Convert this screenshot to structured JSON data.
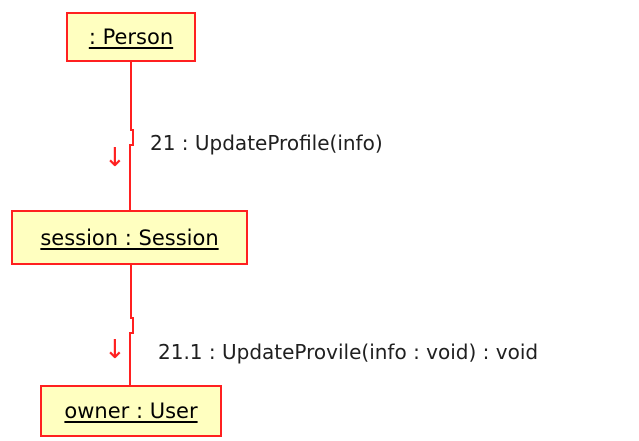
{
  "objects": [
    {
      "label": " : Person"
    },
    {
      "label": "session : Session"
    },
    {
      "label": "owner : User"
    }
  ],
  "messages": [
    {
      "label": "21 : UpdateProfile(info)"
    },
    {
      "label": "21.1 : UpdateProvile(info : void) : void"
    }
  ],
  "colors": {
    "border": "#ff2020",
    "fill": "#ffffc0",
    "link": "#ff2020"
  },
  "icons": {
    "message_arrow": "arrow-down-icon"
  }
}
